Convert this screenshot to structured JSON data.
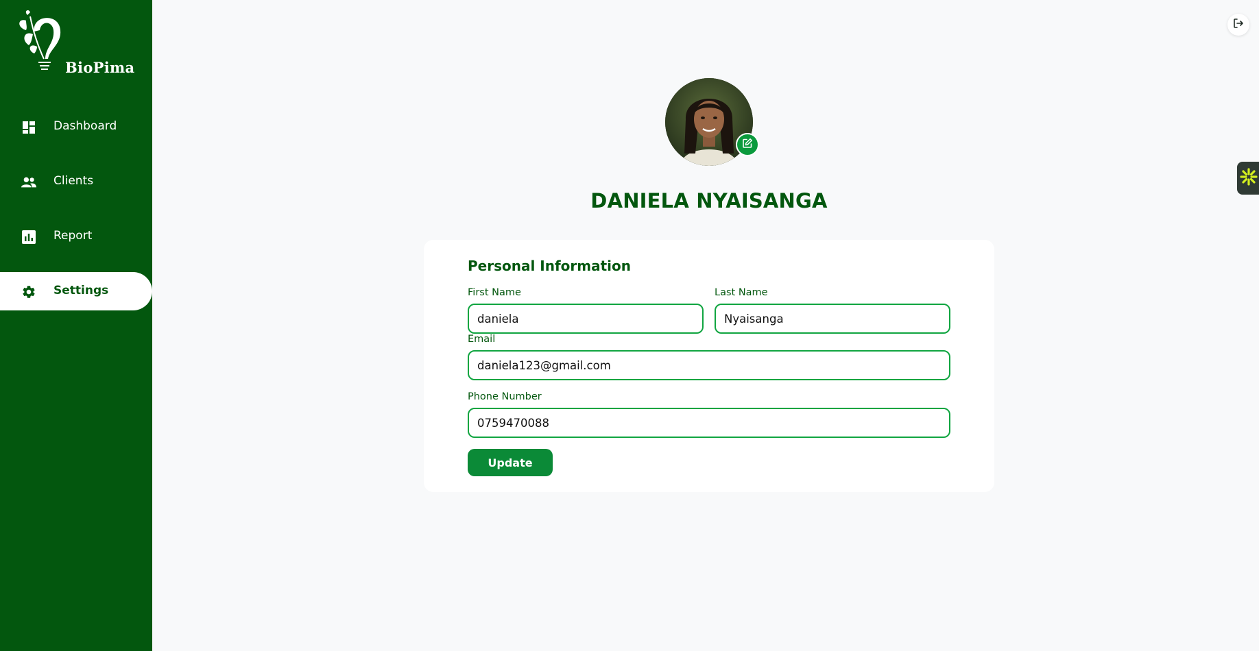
{
  "brand": {
    "name": "BioPima"
  },
  "sidebar": {
    "items": [
      {
        "label": "Dashboard",
        "icon": "dashboard-icon"
      },
      {
        "label": "Clients",
        "icon": "people-icon"
      },
      {
        "label": "Report",
        "icon": "bar-chart-icon"
      },
      {
        "label": "Settings",
        "icon": "gear-icon",
        "active": true
      }
    ]
  },
  "header": {
    "logout_icon": "logout-icon"
  },
  "profile": {
    "name": "DANIELA NYAISANGA",
    "edit_icon": "edit-icon"
  },
  "form": {
    "title": "Personal Information",
    "first_name": {
      "label": "First Name",
      "value": "daniela"
    },
    "last_name": {
      "label": "Last Name",
      "value": "Nyaisanga"
    },
    "email": {
      "label": "Email",
      "value": "daniela123@gmail.com"
    },
    "phone": {
      "label": "Phone Number",
      "value": "0759470088"
    },
    "submit_label": "Update"
  },
  "colors": {
    "primary": "#03570e",
    "accent": "#0b8a37",
    "input_border": "#10a540",
    "background": "#f8f9fa"
  }
}
